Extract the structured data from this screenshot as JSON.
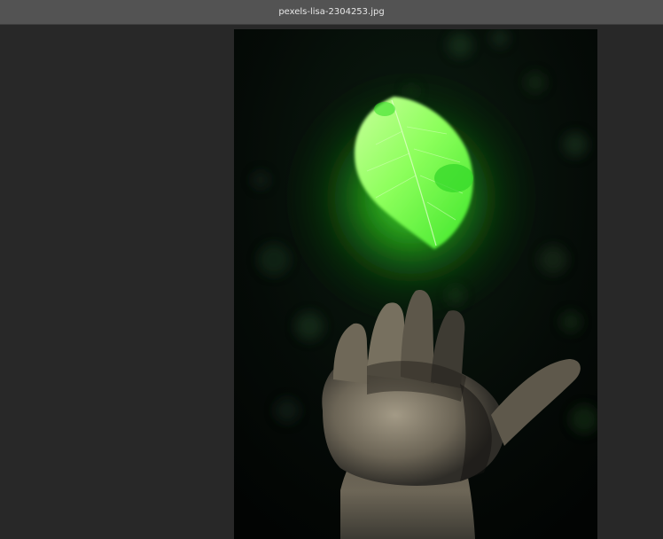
{
  "window": {
    "title": "pexels-lisa-2304253.jpg"
  },
  "colors": {
    "titlebar": "#535353",
    "workspace": "#282828",
    "leaf_glow": "#39ff14",
    "background_dark": "#040806"
  },
  "image": {
    "subject_icon": "leaf-over-hand-photo"
  }
}
